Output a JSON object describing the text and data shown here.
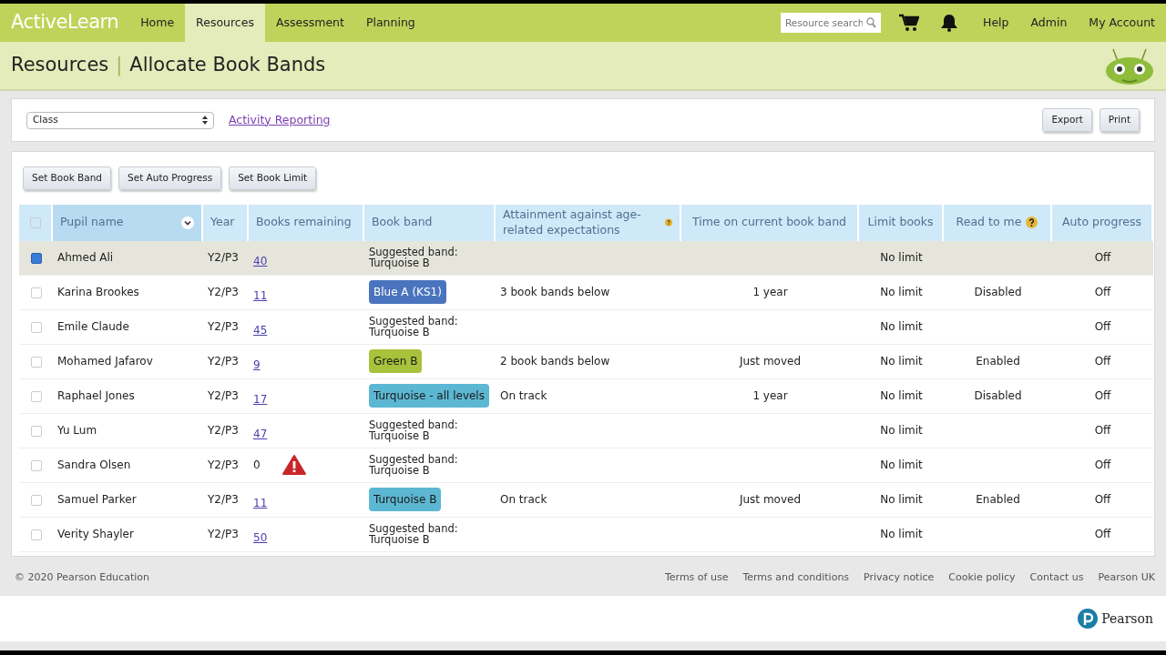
{
  "brand": "ActiveLearn",
  "nav": [
    {
      "label": "Home",
      "selected": false
    },
    {
      "label": "Resources",
      "selected": true
    },
    {
      "label": "Assessment",
      "selected": false
    },
    {
      "label": "Planning",
      "selected": false
    }
  ],
  "search": {
    "placeholder": "Resource search"
  },
  "account_links": [
    "Help",
    "Admin",
    "My Account"
  ],
  "breadcrumb": [
    "Resources",
    "Allocate Book Bands"
  ],
  "breadcrumb_separator": "|",
  "filter": {
    "select_value": "Class",
    "link": "Activity Reporting"
  },
  "actions": [
    "Export",
    "Print"
  ],
  "bulk_buttons": [
    "Set Book Band",
    "Set Auto Progress",
    "Set Book Limit"
  ],
  "table": {
    "select_all_checked": false,
    "columns": [
      {
        "label": "Pupil name",
        "sortable": true,
        "help": false
      },
      {
        "label": "Year",
        "sortable": false,
        "help": false
      },
      {
        "label": "Books remaining",
        "sortable": false,
        "help": false
      },
      {
        "label": "Book band",
        "sortable": false,
        "help": false
      },
      {
        "label": "Attainment against age-related expectations",
        "sortable": false,
        "help": true
      },
      {
        "label": "Time on current book band",
        "sortable": false,
        "help": false
      },
      {
        "label": "Limit books",
        "sortable": false,
        "help": false
      },
      {
        "label": "Read to me",
        "sortable": false,
        "help": true
      },
      {
        "label": "Auto progress",
        "sortable": false,
        "help": false
      }
    ],
    "rows": [
      {
        "selected": true,
        "name": "Ahmed Ali",
        "year": "Y2/P3",
        "books": "40",
        "warning": false,
        "band": {
          "kind": "suggested",
          "lines": [
            "Suggested band:",
            "Turquoise B"
          ]
        },
        "attainment": "",
        "time": "",
        "limit": "No limit",
        "read_to_me": "",
        "auto": "Off"
      },
      {
        "selected": false,
        "name": "Karina Brookes",
        "year": "Y2/P3",
        "books": "11",
        "warning": false,
        "band": {
          "kind": "badge",
          "label": "Blue A (KS1)",
          "color": "#4a74bd"
        },
        "attainment": "3 book bands below",
        "time": "1 year",
        "limit": "No limit",
        "read_to_me": "Disabled",
        "auto": "Off"
      },
      {
        "selected": false,
        "name": "Emile Claude",
        "year": "Y2/P3",
        "books": "45",
        "warning": false,
        "band": {
          "kind": "suggested",
          "lines": [
            "Suggested band:",
            "Turquoise B"
          ]
        },
        "attainment": "",
        "time": "",
        "limit": "No limit",
        "read_to_me": "",
        "auto": "Off"
      },
      {
        "selected": false,
        "name": "Mohamed Jafarov",
        "year": "Y2/P3",
        "books": "9",
        "warning": false,
        "band": {
          "kind": "badge",
          "label": "Green B",
          "color": "#a9c23c"
        },
        "attainment": "2 book bands below",
        "time": "Just moved",
        "limit": "No limit",
        "read_to_me": "Enabled",
        "auto": "Off"
      },
      {
        "selected": false,
        "name": "Raphael Jones",
        "year": "Y2/P3",
        "books": "17",
        "warning": false,
        "band": {
          "kind": "badge",
          "label": "Turquoise - all levels",
          "color": "#5cb7d2"
        },
        "attainment": "On track",
        "time": "1 year",
        "limit": "No limit",
        "read_to_me": "Disabled",
        "auto": "Off"
      },
      {
        "selected": false,
        "name": "Yu Lum",
        "year": "Y2/P3",
        "books": "47",
        "warning": false,
        "band": {
          "kind": "suggested",
          "lines": [
            "Suggested band:",
            "Turquoise B"
          ]
        },
        "attainment": "",
        "time": "",
        "limit": "No limit",
        "read_to_me": "",
        "auto": "Off"
      },
      {
        "selected": false,
        "name": "Sandra Olsen",
        "year": "Y2/P3",
        "books": "0",
        "warning": true,
        "band": {
          "kind": "suggested",
          "lines": [
            "Suggested band:",
            "Turquoise B"
          ]
        },
        "attainment": "",
        "time": "",
        "limit": "No limit",
        "read_to_me": "",
        "auto": "Off"
      },
      {
        "selected": false,
        "name": "Samuel Parker",
        "year": "Y2/P3",
        "books": "11",
        "warning": false,
        "band": {
          "kind": "badge",
          "label": "Turquoise B",
          "color": "#5cb7d2"
        },
        "attainment": "On track",
        "time": "Just moved",
        "limit": "No limit",
        "read_to_me": "Enabled",
        "auto": "Off"
      },
      {
        "selected": false,
        "name": "Verity Shayler",
        "year": "Y2/P3",
        "books": "50",
        "warning": false,
        "band": {
          "kind": "suggested",
          "lines": [
            "Suggested band:",
            "Turquoise B"
          ]
        },
        "attainment": "",
        "time": "",
        "limit": "No limit",
        "read_to_me": "",
        "auto": "Off"
      }
    ]
  },
  "copyright": "© 2020 Pearson Education",
  "footer_links": [
    "Terms of use",
    "Terms and conditions",
    "Privacy notice",
    "Cookie policy",
    "Contact us",
    "Pearson UK"
  ],
  "footer_logo": "Pearson"
}
